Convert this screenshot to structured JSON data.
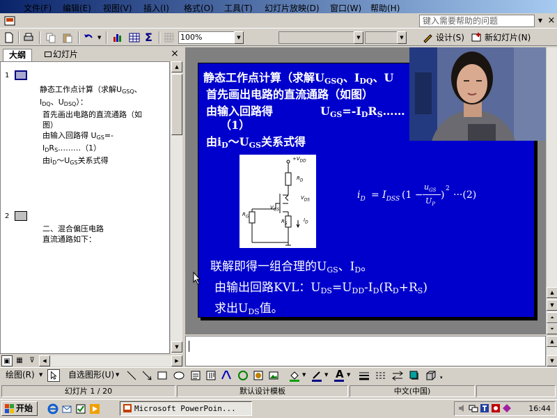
{
  "menu": {
    "items": [
      "文件(F)",
      "编辑(E)",
      "视图(V)",
      "插入(I)",
      "格式(O)",
      "工具(T)",
      "幻灯片放映(D)",
      "窗口(W)",
      "帮助(H)"
    ],
    "help_placeholder": "键入需要帮助的问题"
  },
  "toolbar": {
    "zoom": "100%",
    "design_label": "设计(S)",
    "new_slide_label": "新幻灯片(N)"
  },
  "panel": {
    "tab_outline": "大纲",
    "tab_slides": "幻灯片",
    "close": "×"
  },
  "outline": {
    "slide1_number": "1",
    "slide1_lines": [
      [
        "静态工作点计算（求解U",
        "GSQ",
        "、"
      ],
      [
        "I",
        "DQ",
        "、U",
        "DSQ",
        "）："
      ],
      [
        "首先画出电路的直流通路（如"
      ],
      [
        "图）"
      ],
      [
        "由输入回路得          U",
        "GS",
        "=-"
      ],
      [
        "I",
        "D",
        "R",
        "S",
        "………（1）"
      ],
      [
        "由i",
        "D",
        "～U",
        "GS",
        "关系式得"
      ]
    ],
    "slide2_number": "2",
    "slide2_lines": [
      [
        "二、混合偏压电路"
      ],
      [
        "直流通路如下："
      ]
    ]
  },
  "slide": {
    "title_parts": [
      "静态工作点计算（求解U",
      "GSQ",
      "、I",
      "DQ",
      "、U"
    ],
    "line2": "首先画出电路的直流通路（如图）",
    "line3_parts": [
      "由输入回路得",
      "U",
      "GS",
      "=-I",
      "D",
      "R",
      "S",
      "……"
    ],
    "line4": "（1）",
    "line5_parts": [
      "由i",
      "D",
      "～U",
      "GS",
      "关系式得"
    ],
    "formula": {
      "lhs": "i",
      "lhs_sub": "D",
      "eq": "= I",
      "eq_sub": "DSS",
      "open": "(1 −",
      "num": "u",
      "num_sub": "GS",
      "den": "U",
      "den_sub": "P",
      "close": ")",
      "power": "2",
      "tag": "···(2)"
    },
    "line6_parts": [
      "联解即得一组合理的U",
      "GS",
      "、I",
      "D",
      "。"
    ],
    "line7_parts": [
      "由输出回路KVL：U",
      "DS",
      "=U",
      "DD",
      "-I",
      "D",
      "(R",
      "D",
      "+R",
      "S",
      ")"
    ],
    "line8_parts": [
      "求出U",
      "DS",
      "值。"
    ],
    "circuit_labels": {
      "vdd": "+V",
      "vdd_sub": "DD",
      "rd": "R",
      "rd_sub": "D",
      "vds": "V",
      "vds_sub": "DS",
      "vgs": "V",
      "vgs_sub": "GS",
      "rg": "R",
      "rg_sub": "G",
      "rs": "R",
      "rs_sub": "S",
      "id": "I",
      "id_sub": "D"
    }
  },
  "status": {
    "slide": "幻灯片 1 / 20",
    "template": "默认设计模板",
    "language": "中文(中国)"
  },
  "drawbar": {
    "draw_label": "绘图(R)",
    "autoshape_label": "自选图形(U)"
  },
  "taskbar": {
    "start": "开始",
    "task": "Microsoft PowerPoin...",
    "clock": "16:44"
  },
  "colors": {
    "slide_bg": "#0000cc",
    "title_bar": "#0a246a",
    "chrome": "#d4d0c8"
  }
}
